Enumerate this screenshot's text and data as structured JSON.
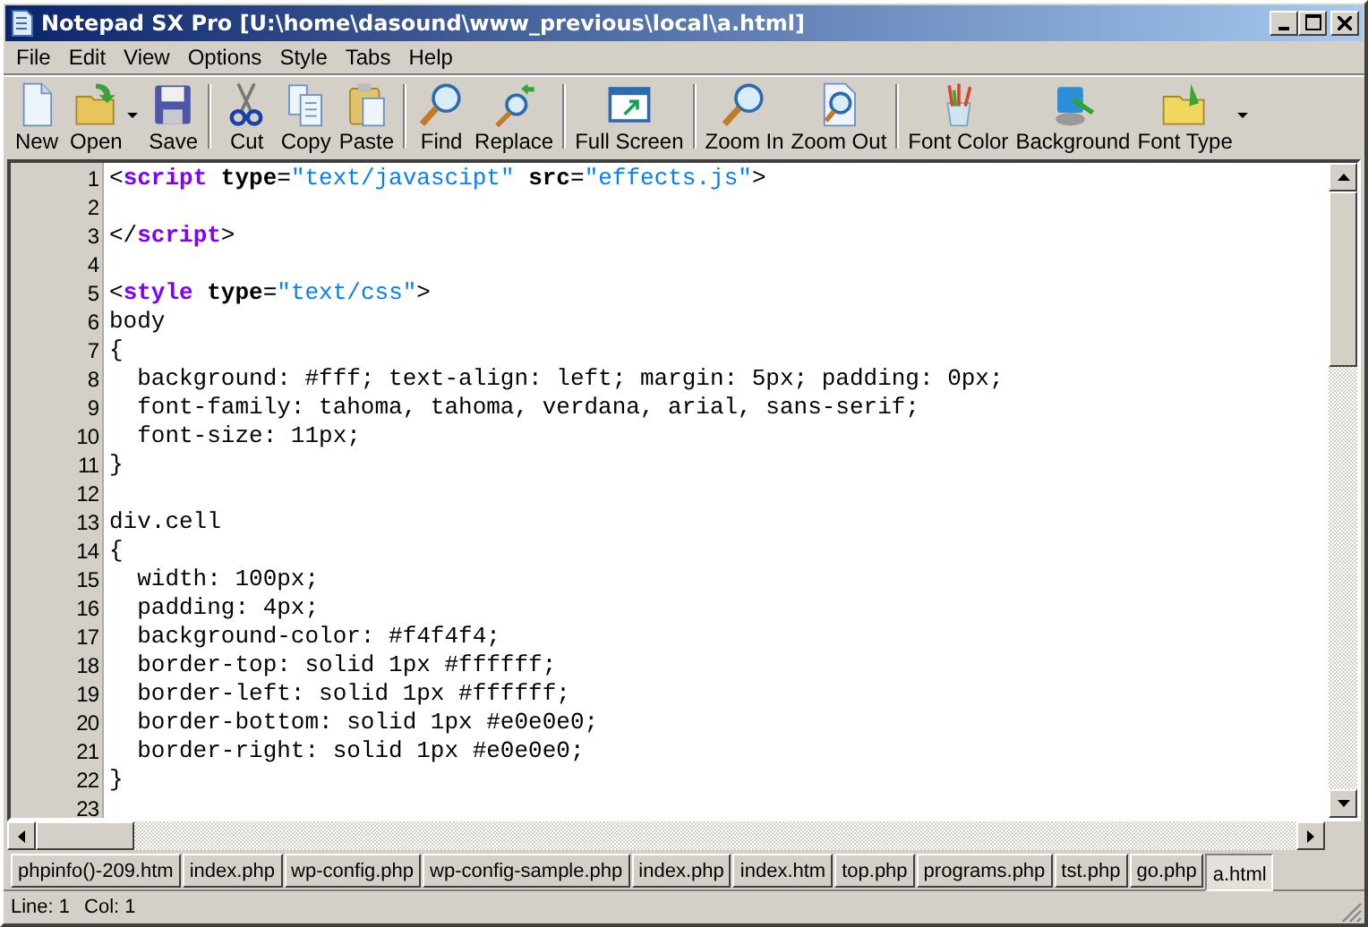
{
  "window": {
    "title": "Notepad SX Pro [U:\\home\\dasound\\www_previous\\local\\a.html]"
  },
  "menu": [
    "File",
    "Edit",
    "View",
    "Options",
    "Style",
    "Tabs",
    "Help"
  ],
  "toolbar": [
    {
      "label": "New",
      "kind": "new"
    },
    {
      "label": "Open",
      "kind": "open",
      "dropdown": true
    },
    {
      "label": "Save",
      "kind": "save",
      "separator_after": true
    },
    {
      "label": "Cut",
      "kind": "cut"
    },
    {
      "label": "Copy",
      "kind": "copy"
    },
    {
      "label": "Paste",
      "kind": "paste",
      "separator_after": true
    },
    {
      "label": "Find",
      "kind": "find"
    },
    {
      "label": "Replace",
      "kind": "replace",
      "separator_after": true
    },
    {
      "label": "Full Screen",
      "kind": "fullscreen",
      "separator_after": true
    },
    {
      "label": "Zoom In",
      "kind": "zoomin"
    },
    {
      "label": "Zoom Out",
      "kind": "zoomout",
      "separator_after": true
    },
    {
      "label": "Font Color",
      "kind": "fontcolor"
    },
    {
      "label": "Background",
      "kind": "background"
    },
    {
      "label": "Font Type",
      "kind": "fonttype",
      "dropdown": true
    }
  ],
  "editor": {
    "lines": [
      {
        "number": "1",
        "tokens": [
          {
            "kind": "punct",
            "text": "<"
          },
          {
            "kind": "tag",
            "text": "script"
          },
          {
            "kind": "attr",
            "text": " type"
          },
          {
            "kind": "punct",
            "text": "="
          },
          {
            "kind": "str",
            "text": "\"text/javascipt\""
          },
          {
            "kind": "attr",
            "text": " src"
          },
          {
            "kind": "punct",
            "text": "="
          },
          {
            "kind": "str",
            "text": "\"effects.js\""
          },
          {
            "kind": "punct",
            "text": ">"
          }
        ]
      },
      {
        "number": "2"
      },
      {
        "number": "3",
        "tokens": [
          {
            "kind": "punct",
            "text": "</"
          },
          {
            "kind": "tag",
            "text": "script"
          },
          {
            "kind": "punct",
            "text": ">"
          }
        ]
      },
      {
        "number": "4"
      },
      {
        "number": "5",
        "tokens": [
          {
            "kind": "punct",
            "text": "<"
          },
          {
            "kind": "tag",
            "text": "style"
          },
          {
            "kind": "attr",
            "text": " type"
          },
          {
            "kind": "punct",
            "text": "="
          },
          {
            "kind": "str",
            "text": "\"text/css\""
          },
          {
            "kind": "punct",
            "text": ">"
          }
        ]
      },
      {
        "number": "6",
        "tokens": [
          {
            "kind": "plain",
            "text": "body"
          }
        ]
      },
      {
        "number": "7",
        "tokens": [
          {
            "kind": "plain",
            "text": "{"
          }
        ]
      },
      {
        "number": "8",
        "tokens": [
          {
            "kind": "plain",
            "text": "  background: #fff; text-align: left; margin: 5px; padding: 0px;"
          }
        ]
      },
      {
        "number": "9",
        "tokens": [
          {
            "kind": "plain",
            "text": "  font-family: tahoma, tahoma, verdana, arial, sans-serif;"
          }
        ]
      },
      {
        "number": "10",
        "tokens": [
          {
            "kind": "plain",
            "text": "  font-size: 11px;"
          }
        ]
      },
      {
        "number": "11",
        "tokens": [
          {
            "kind": "plain",
            "text": "}"
          }
        ]
      },
      {
        "number": "12"
      },
      {
        "number": "13",
        "tokens": [
          {
            "kind": "plain",
            "text": "div.cell"
          }
        ]
      },
      {
        "number": "14",
        "tokens": [
          {
            "kind": "plain",
            "text": "{"
          }
        ]
      },
      {
        "number": "15",
        "tokens": [
          {
            "kind": "plain",
            "text": "  width: 100px;"
          }
        ]
      },
      {
        "number": "16",
        "tokens": [
          {
            "kind": "plain",
            "text": "  padding: 4px;"
          }
        ]
      },
      {
        "number": "17",
        "tokens": [
          {
            "kind": "plain",
            "text": "  background-color: #f4f4f4;"
          }
        ]
      },
      {
        "number": "18",
        "tokens": [
          {
            "kind": "plain",
            "text": "  border-top: solid 1px #ffffff;"
          }
        ]
      },
      {
        "number": "19",
        "tokens": [
          {
            "kind": "plain",
            "text": "  border-left: solid 1px #ffffff;"
          }
        ]
      },
      {
        "number": "20",
        "tokens": [
          {
            "kind": "plain",
            "text": "  border-bottom: solid 1px #e0e0e0;"
          }
        ]
      },
      {
        "number": "21",
        "tokens": [
          {
            "kind": "plain",
            "text": "  border-right: solid 1px #e0e0e0;"
          }
        ]
      },
      {
        "number": "22",
        "tokens": [
          {
            "kind": "plain",
            "text": "}"
          }
        ]
      },
      {
        "number": "23"
      }
    ]
  },
  "tabs": [
    {
      "label": "phpinfo()-209.htm",
      "selected": false
    },
    {
      "label": "index.php",
      "selected": false
    },
    {
      "label": "wp-config.php",
      "selected": false
    },
    {
      "label": "wp-config-sample.php",
      "selected": false
    },
    {
      "label": "index.php",
      "selected": false
    },
    {
      "label": "index.htm",
      "selected": false
    },
    {
      "label": "top.php",
      "selected": false
    },
    {
      "label": "programs.php",
      "selected": false
    },
    {
      "label": "tst.php",
      "selected": false
    },
    {
      "label": "go.php",
      "selected": false
    },
    {
      "label": "a.html",
      "selected": true
    }
  ],
  "status_bar": {
    "line": "Line: 1",
    "col": "Col: 1"
  }
}
